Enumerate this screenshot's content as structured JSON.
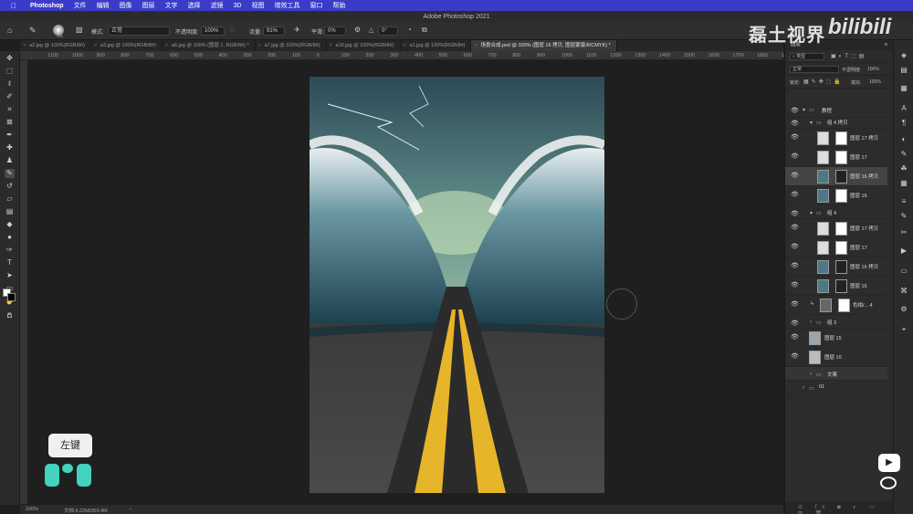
{
  "menubar": {
    "app": "Photoshop",
    "items": [
      "文件",
      "编辑",
      "图像",
      "图层",
      "文字",
      "选择",
      "滤镜",
      "3D",
      "视图",
      "增效工具",
      "窗口",
      "帮助"
    ]
  },
  "window_title": "Adobe Photoshop 2021",
  "options": {
    "brush_size": "175",
    "mode_label": "模式:",
    "mode_value": "正常",
    "opacity_label": "不透明度:",
    "opacity_value": "100%",
    "flow_label": "流量:",
    "flow_value": "91%",
    "smooth_label": "平滑:",
    "smooth_value": "0%",
    "angle_value": "0°"
  },
  "tabs": [
    {
      "label": "a2.jpg @ 100%(RGB/8#)",
      "active": false
    },
    {
      "label": "a3.jpg @ 100%(RGB/8#)",
      "active": false
    },
    {
      "label": "a6.jpg @ 100% (图层 1, RGB/8#) *",
      "active": false
    },
    {
      "label": "a7.jpg @ 100%(RGB/8#)",
      "active": false
    },
    {
      "label": "a10.jpg @ 100%(RGB/8#)",
      "active": false
    },
    {
      "label": "a1.jpg @ 100%(RGB/8#)",
      "active": false
    },
    {
      "label": "场景合成.psd @ 100% (图层 16 拷贝, 图层蒙版/8/CMYK) *",
      "active": true
    }
  ],
  "ruler": [
    "1100",
    "1000",
    "900",
    "800",
    "700",
    "600",
    "500",
    "400",
    "300",
    "200",
    "100",
    "0",
    "100",
    "200",
    "300",
    "400",
    "500",
    "600",
    "700",
    "800",
    "900",
    "1000",
    "1100",
    "1200",
    "1300",
    "1400",
    "1500",
    "1600",
    "1700",
    "1800",
    "1900"
  ],
  "status": {
    "zoom": "100%",
    "doc": "文档:6.22M/359.4M"
  },
  "overlay": {
    "toast": "左键"
  },
  "watermark": {
    "channel": "磊土视界",
    "site": "bilibili"
  },
  "layers_panel": {
    "title": "图层",
    "filter": "类型",
    "blend": "正常",
    "opacity_label": "不透明度:",
    "opacity": "100%",
    "lock_label": "锁定:",
    "fill_label": "填充:",
    "fill": "100%",
    "rows": [
      {
        "name": "教程",
        "kind": "group"
      },
      {
        "name": "组 4 拷贝",
        "kind": "group"
      },
      {
        "name": "图层 17 拷贝",
        "kind": "layer"
      },
      {
        "name": "图层 17",
        "kind": "layer"
      },
      {
        "name": "图层 16 拷贝",
        "kind": "layer",
        "selected": true
      },
      {
        "name": "图层 16",
        "kind": "layer"
      },
      {
        "name": "组 4",
        "kind": "group"
      },
      {
        "name": "图层 17 拷贝",
        "kind": "layer"
      },
      {
        "name": "图层 17",
        "kind": "layer"
      },
      {
        "name": "图层 16 拷贝",
        "kind": "layer"
      },
      {
        "name": "图层 16",
        "kind": "layer"
      },
      {
        "name": "色相/... 4",
        "kind": "adjust"
      },
      {
        "name": "组 3",
        "kind": "group"
      },
      {
        "name": "图层 15",
        "kind": "layer"
      },
      {
        "name": "图层 10",
        "kind": "layer"
      },
      {
        "name": "文案",
        "kind": "group"
      },
      {
        "name": "01",
        "kind": "group"
      }
    ]
  }
}
